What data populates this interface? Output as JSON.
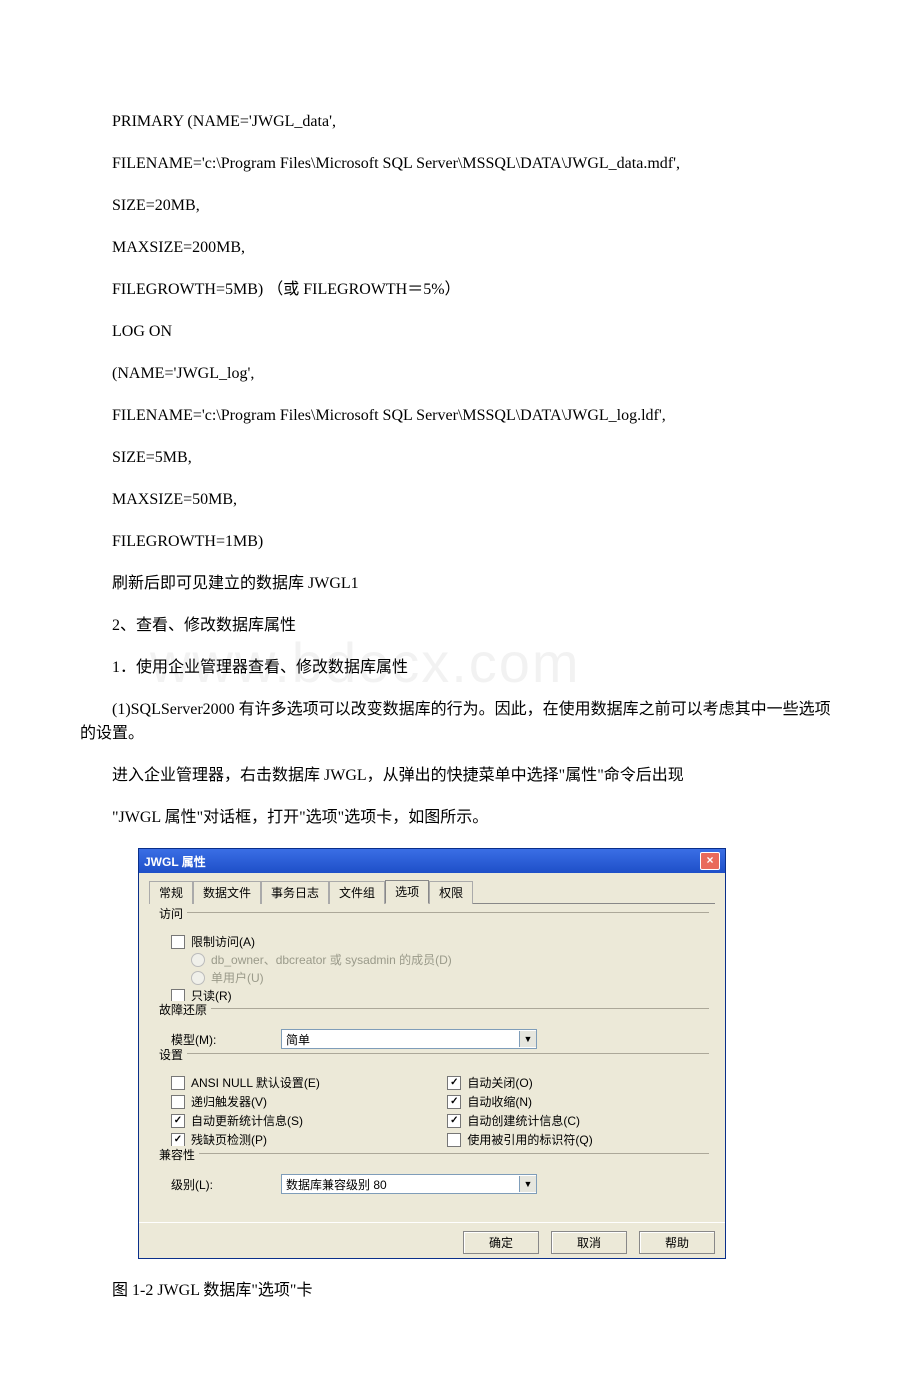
{
  "text": {
    "p1": "PRIMARY (NAME='JWGL_data',",
    "p2": "FILENAME='c:\\Program Files\\Microsoft SQL Server\\MSSQL\\DATA\\JWGL_data.mdf',",
    "p3": "SIZE=20MB,",
    "p4": "MAXSIZE=200MB,",
    "p5": " FILEGROWTH=5MB) （或 FILEGROWTH＝5%）",
    "p6": "LOG ON",
    "p7": " (NAME='JWGL_log',",
    "p8": "FILENAME='c:\\Program Files\\Microsoft SQL Server\\MSSQL\\DATA\\JWGL_log.ldf',",
    "p9": "SIZE=5MB,",
    "p10": "MAXSIZE=50MB,",
    "p11": "FILEGROWTH=1MB)",
    "p12": "刷新后即可见建立的数据库 JWGL1",
    "p13": "2、查看、修改数据库属性",
    "p14": "1．使用企业管理器查看、修改数据库属性",
    "p15": "(1)SQLServer2000 有许多选项可以改变数据库的行为。因此，在使用数据库之前可以考虑其中一些选项的设置。",
    "p16": "进入企业管理器，右击数据库 JWGL，从弹出的快捷菜单中选择\"属性\"命令后出现",
    "p17": "\"JWGL 属性\"对话框，打开\"选项\"选项卡，如图所示。",
    "caption": "图 1-2 JWGL 数据库\"选项\"卡",
    "watermark": "www.bdocx.com"
  },
  "dialog": {
    "title": "JWGL 属性",
    "close": "×",
    "tabs": [
      "常规",
      "数据文件",
      "事务日志",
      "文件组",
      "选项",
      "权限"
    ],
    "active_tab_index": 4,
    "access": {
      "legend": "访问",
      "restrict": "限制访问(A)",
      "members": "db_owner、dbcreator 或 sysadmin 的成员(D)",
      "single": "单用户(U)",
      "readonly": "只读(R)"
    },
    "recovery": {
      "legend": "故障还原",
      "model_label": "模型(M):",
      "model_value": "简单"
    },
    "settings": {
      "legend": "设置",
      "ansi": "ANSI NULL 默认设置(E)",
      "recursive": "递归触发器(V)",
      "autostats": "自动更新统计信息(S)",
      "torn": "残缺页检测(P)",
      "autoclose": "自动关闭(O)",
      "autoshrink": "自动收缩(N)",
      "autocreate": "自动创建统计信息(C)",
      "quoted": "使用被引用的标识符(Q)"
    },
    "compat": {
      "legend": "兼容性",
      "level_label": "级别(L):",
      "level_value": "数据库兼容级别 80"
    },
    "buttons": {
      "ok": "确定",
      "cancel": "取消",
      "help": "帮助"
    }
  }
}
